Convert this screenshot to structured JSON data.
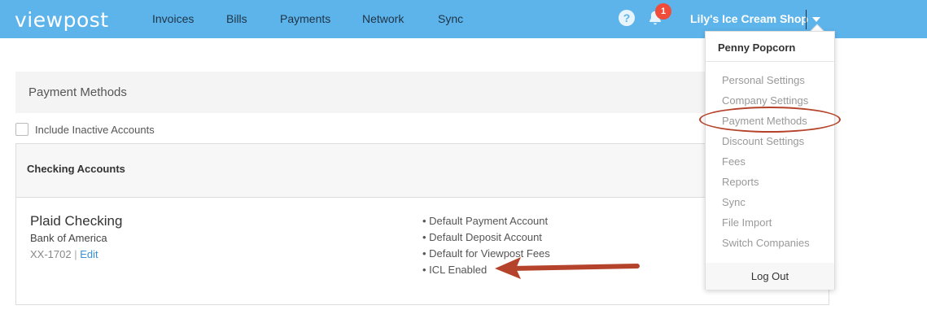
{
  "brand": {
    "logo": "viewpost",
    "logo_mark": "."
  },
  "nav": {
    "items": [
      "Invoices",
      "Bills",
      "Payments",
      "Network",
      "Sync"
    ]
  },
  "header": {
    "help": "?",
    "notifications_count": "1",
    "company": "Lily's Ice Cream Shop"
  },
  "page": {
    "title": "Payment Methods",
    "include_inactive_label": "Include Inactive Accounts",
    "include_inactive_checked": false
  },
  "accounts_section": {
    "title": "Checking Accounts",
    "account": {
      "name": "Plaid Checking",
      "bank": "Bank of America",
      "number": "XX-1702",
      "edit_label": "Edit",
      "features": [
        "• Default Payment Account",
        "• Default Deposit Account",
        "• Default for Viewpost Fees",
        "• ICL Enabled"
      ]
    }
  },
  "dropdown": {
    "user": "Penny Popcorn",
    "items": [
      "Personal Settings",
      "Company Settings",
      "Payment Methods",
      "Discount Settings",
      "Fees",
      "Reports",
      "Sync",
      "File Import",
      "Switch Companies"
    ],
    "logout": "Log Out"
  },
  "colors": {
    "nav_bg": "#5db4ea",
    "annotation": "#b5432b",
    "link": "#3a8fd6",
    "badge": "#f04c3a"
  }
}
